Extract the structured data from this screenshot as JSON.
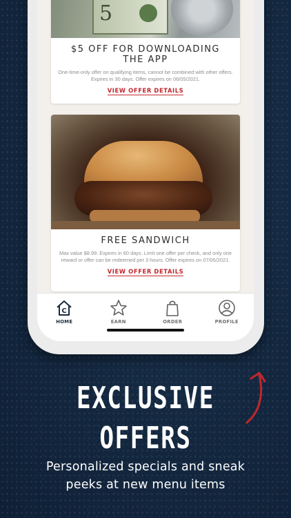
{
  "offers": [
    {
      "title": "$5 OFF FOR DOWNLOADING THE APP",
      "description": "One-time-only offer on qualifying items, cannot be combined with other offers. Expires in 30 days. Offer expires on 06/05/2021.",
      "link_label": "VIEW OFFER DETAILS",
      "image_icon": "five-dollar-bill-image"
    },
    {
      "title": "FREE SANDWICH",
      "description": "Max value $8.99. Expires in 60 days. Limit one offer per check, and only one reward or offer can be redeemed per 3 hours. Offer expires on 07/05/2021.",
      "link_label": "VIEW OFFER DETAILS",
      "image_icon": "sandwich-image"
    }
  ],
  "tabbar": {
    "items": [
      {
        "label": "HOME",
        "icon": "home-icon",
        "active": true
      },
      {
        "label": "EARN",
        "icon": "star-icon",
        "active": false
      },
      {
        "label": "ORDER",
        "icon": "bag-icon",
        "active": false
      },
      {
        "label": "PROFILE",
        "icon": "profile-icon",
        "active": false
      }
    ]
  },
  "marketing": {
    "headline_line1": "EXCLUSIVE",
    "headline_line2": "OFFERS",
    "subtitle": "Personalized specials and sneak peeks at new menu items"
  },
  "colors": {
    "background": "#13273f",
    "accent": "#c1272d",
    "arrow": "#c1272d",
    "text_dark": "#2b2b2b"
  }
}
